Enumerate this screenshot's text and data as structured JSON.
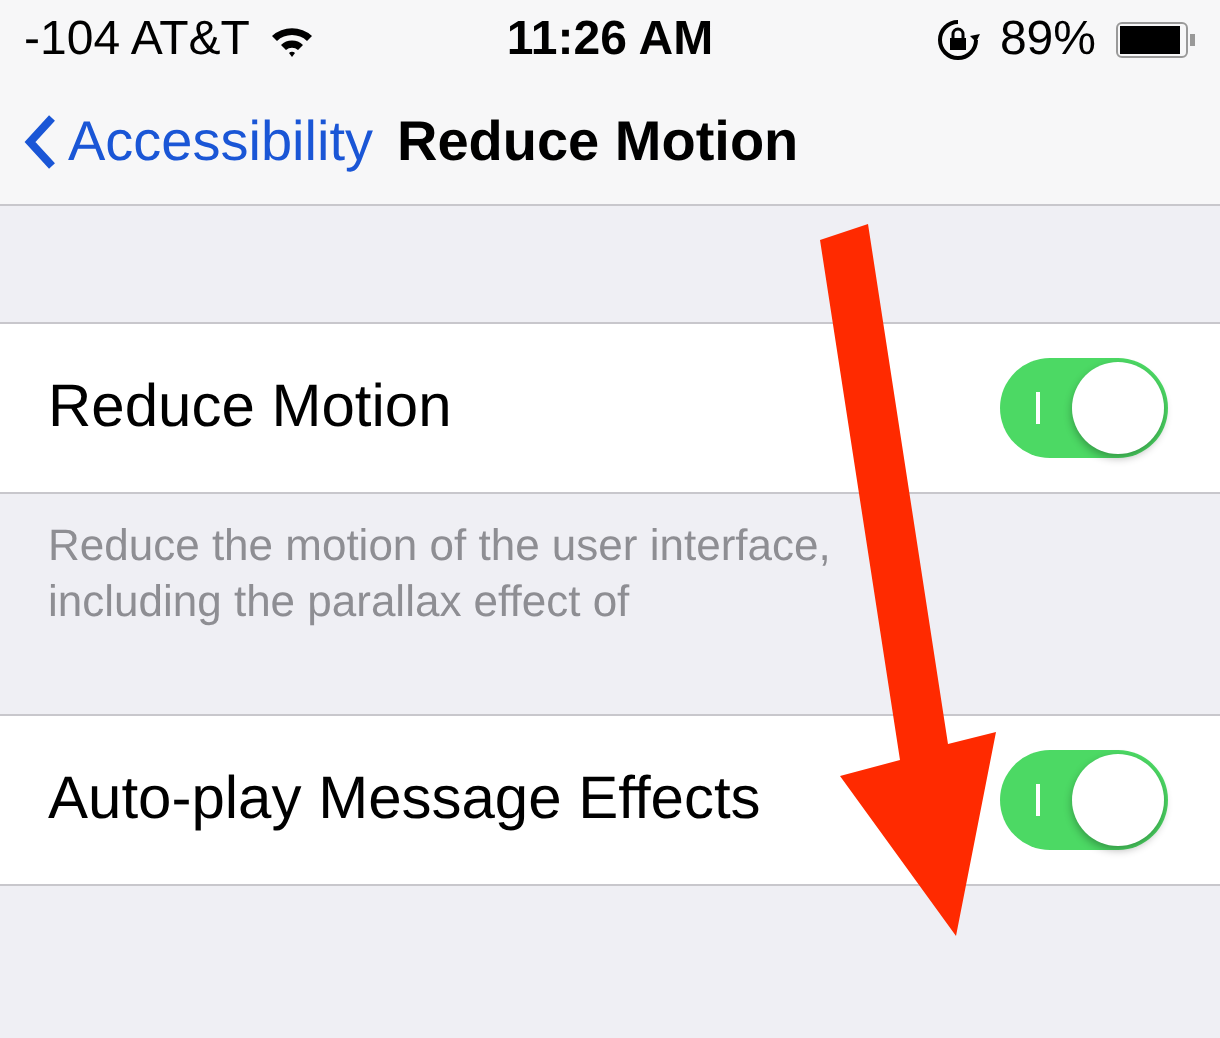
{
  "status_bar": {
    "carrier": "-104 AT&T",
    "time": "11:26 AM",
    "battery": "89%"
  },
  "nav": {
    "back": "Accessibility",
    "title": "Reduce Motion"
  },
  "sections": [
    {
      "rows": [
        {
          "label": "Reduce Motion",
          "on": true
        }
      ],
      "footer": "Reduce the motion of the user interface, including the parallax effect of"
    },
    {
      "rows": [
        {
          "label": "Auto-play Message Effects",
          "on": true
        }
      ]
    }
  ]
}
